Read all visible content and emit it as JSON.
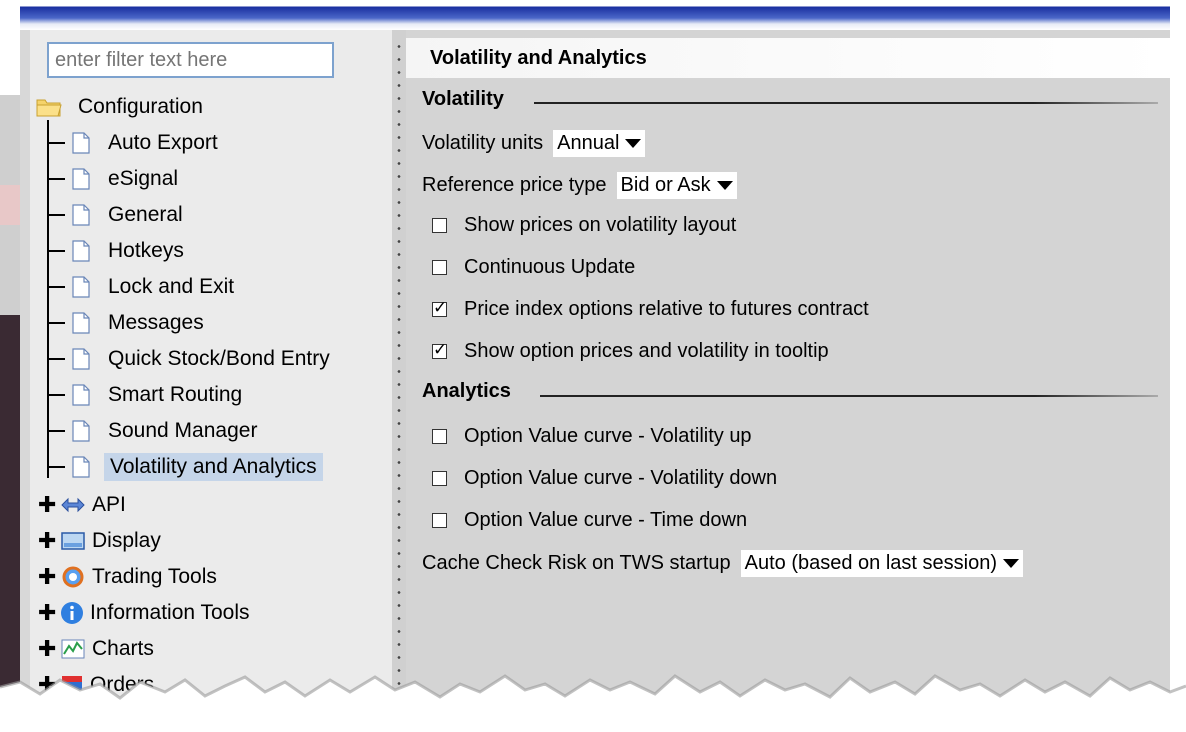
{
  "filter": {
    "placeholder": "enter filter text here"
  },
  "tree": {
    "root": "Configuration",
    "children": [
      "Auto Export",
      "eSignal",
      "General",
      "Hotkeys",
      "Lock and Exit",
      "Messages",
      "Quick Stock/Bond Entry",
      "Smart Routing",
      "Sound Manager",
      "Volatility and Analytics"
    ],
    "selected": "Volatility and Analytics",
    "groups": [
      {
        "label": "API",
        "icon": "api-icon"
      },
      {
        "label": "Display",
        "icon": "display-icon"
      },
      {
        "label": "Trading Tools",
        "icon": "trading-tools-icon"
      },
      {
        "label": "Information Tools",
        "icon": "info-icon"
      },
      {
        "label": "Charts",
        "icon": "charts-icon"
      },
      {
        "label": "Orders",
        "icon": "orders-icon"
      }
    ]
  },
  "main": {
    "title": "Volatility and Analytics",
    "volatility_section": "Volatility",
    "volatility_units_label": "Volatility units",
    "volatility_units_value": "Annual",
    "reference_price_label": "Reference price type",
    "reference_price_value": "Bid or Ask",
    "options": [
      {
        "label": "Show prices on volatility layout",
        "checked": false
      },
      {
        "label": "Continuous Update",
        "checked": false
      },
      {
        "label": "Price index options relative to futures contract",
        "checked": true
      },
      {
        "label": "Show option prices and volatility in tooltip",
        "checked": true
      }
    ],
    "analytics_section": "Analytics",
    "analytics_options": [
      {
        "label": "Option Value curve - Volatility up",
        "checked": false
      },
      {
        "label": "Option Value curve - Volatility down",
        "checked": false
      },
      {
        "label": "Option Value curve - Time down",
        "checked": false
      }
    ],
    "cache_label": "Cache Check Risk on TWS startup",
    "cache_value": "Auto (based on last session)"
  },
  "colors": {
    "title_bar": "#1a2fa0",
    "selection": "#c5d5e9",
    "filter_border": "#7da2ce"
  }
}
